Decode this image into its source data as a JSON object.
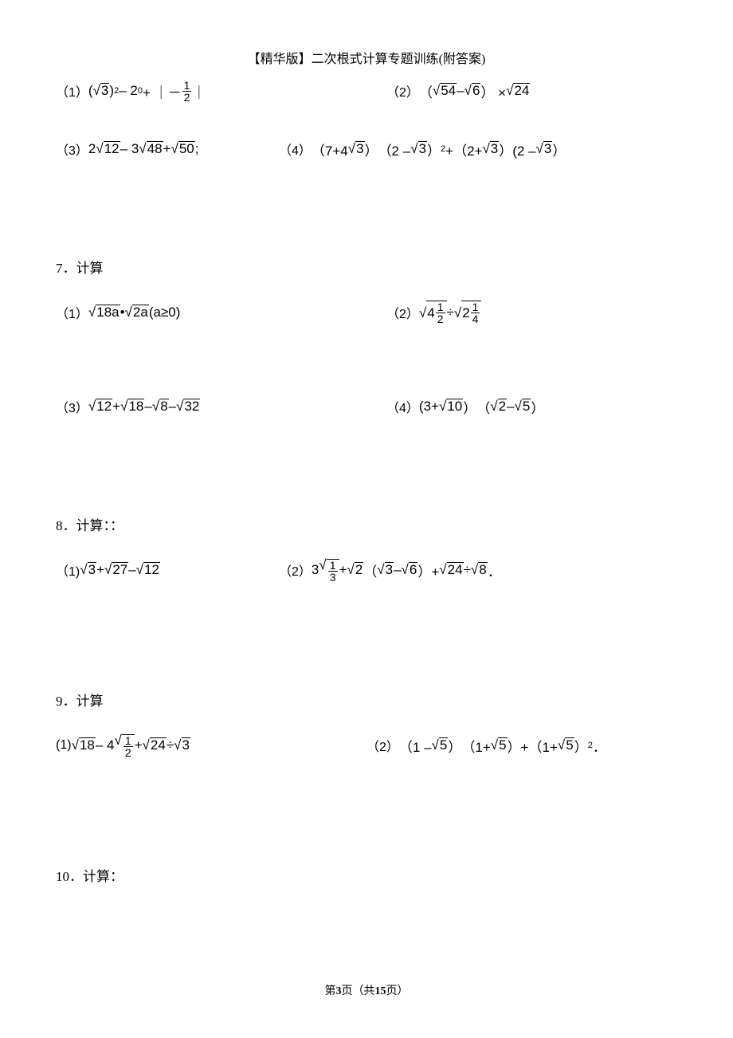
{
  "header": "【精华版】二次根式计算专题训练(附答案)",
  "group6": {
    "p1_label": "（1）",
    "p1_expr_pre": "(",
    "p1_sqrt1": "3",
    "p1_expr_post1": ")",
    "p1_exp1": "2",
    "p1_minus": " – 2",
    "p1_exp2": "0",
    "p1_plus_abs": "+ ｜－",
    "p1_frac_num": "1",
    "p1_frac_den": "2",
    "p1_abs_close": "｜",
    "p2_label": "（2）",
    "p2_lparen": "（",
    "p2_sqrt1": "54",
    "p2_minus": " – ",
    "p2_sqrt2": "6",
    "p2_rparen_times": "） ×",
    "p2_sqrt3": "24",
    "p3_label": "（3）",
    "p3_two": "2",
    "p3_sqrt1": "12",
    "p3_minus1": " – 3",
    "p3_sqrt2": "48",
    "p3_plus": "+",
    "p3_sqrt3": "50",
    "p3_semi": ";",
    "p4_label": "（4）",
    "p4_lparen1": "（7+4",
    "p4_sqrt1": "3",
    "p4_rparen1": "）",
    "p4_lparen2": "（2 – ",
    "p4_sqrt2": "3",
    "p4_rparen2": " ）",
    "p4_exp1": "2",
    "p4_plus": "+（2+",
    "p4_sqrt3": "3",
    "p4_rparen3": "）(2 – ",
    "p4_sqrt4": "3",
    "p4_rparen4": "）"
  },
  "section7": {
    "heading": "7．计算",
    "p1_label": "（1）",
    "p1_sqrt1": "18a",
    "p1_dot": "•",
    "p1_sqrt2": "2a",
    "p1_cond": "(a≥0)",
    "p2_label": "（2）",
    "p2_four": "4",
    "p2_frac1_num": "1",
    "p2_frac1_den": "2",
    "p2_div": " ÷ ",
    "p2_two": "2",
    "p2_frac2_num": "1",
    "p2_frac2_den": "4",
    "p3_label": "（3）",
    "p3_sqrt1": "12",
    "p3_plus": "+",
    "p3_sqrt2": "18",
    "p3_minus1": " – ",
    "p3_sqrt3": "8",
    "p3_minus2": " – ",
    "p3_sqrt4": "32",
    "p4_label": "（4）",
    "p4_lparen1": "(3+",
    "p4_sqrt1": "10",
    "p4_rparen1": "）",
    "p4_lparen2": "（",
    "p4_sqrt2": "2",
    "p4_minus": " – ",
    "p4_sqrt3": "5",
    "p4_rparen2": "）"
  },
  "section8": {
    "heading": "8．计算：：",
    "p1_label": "（1)",
    "p1_sqrt1": "3",
    "p1_plus": "+",
    "p1_sqrt2": "27",
    "p1_minus": " – ",
    "p1_sqrt3": "12",
    "p2_label": "（2）",
    "p2_three": "3",
    "p2_frac_num": "1",
    "p2_frac_den": "3",
    "p2_plus1": "+",
    "p2_sqrt2": "2",
    "p2_lparen": "（",
    "p2_sqrt3": "3",
    "p2_minus": " – ",
    "p2_sqrt4": "6",
    "p2_rparen": "）+",
    "p2_sqrt5": "24",
    "p2_div": "÷",
    "p2_sqrt6": "8",
    "p2_period": "．"
  },
  "section9": {
    "heading": "9．计算",
    "p1_label": "(1)",
    "p1_sqrt1": "18",
    "p1_minus": " – 4",
    "p1_frac_num": "1",
    "p1_frac_den": "2",
    "p1_plus": "+",
    "p1_sqrt3": "24",
    "p1_div": "÷",
    "p1_sqrt4": "3",
    "p2_label": "（2）",
    "p2_lparen1": "（1 – ",
    "p2_sqrt1": "5",
    "p2_rparen1": "）",
    "p2_lparen2": "（1+",
    "p2_sqrt2": "5",
    "p2_rparen2": "）+（1+",
    "p2_sqrt3": "5",
    "p2_rparen3": "）",
    "p2_exp": "2",
    "p2_period": "．"
  },
  "section10": {
    "heading": "10．计算："
  },
  "footer": {
    "pre": "第",
    "current": "3",
    "mid": "页（共",
    "total": "15",
    "suf": "页）"
  }
}
